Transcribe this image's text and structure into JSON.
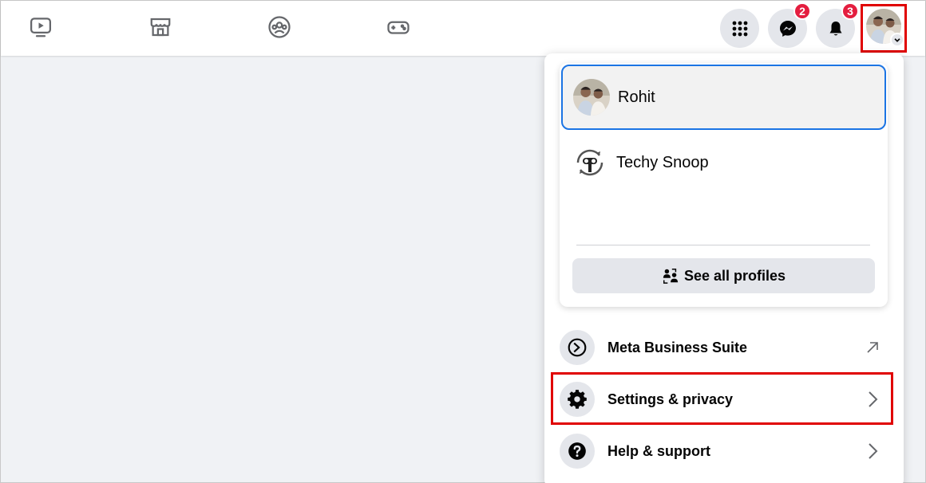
{
  "topbar": {
    "nav_icons": [
      "video-icon",
      "marketplace-icon",
      "groups-icon",
      "gaming-icon"
    ],
    "menu_button_icon": "grid-icon",
    "messenger_badge": "2",
    "notifications_badge": "3"
  },
  "profiles": [
    {
      "name": "Rohit",
      "active": true
    },
    {
      "name": "Techy Snoop",
      "active": false
    }
  ],
  "see_all_profiles": "See all profiles",
  "menu_items": [
    {
      "label": "Meta Business Suite",
      "icon": "meta-business-icon",
      "trail": "external-arrow-icon"
    },
    {
      "label": "Settings & privacy",
      "icon": "gear-icon",
      "trail": "chevron-right-icon"
    },
    {
      "label": "Help & support",
      "icon": "question-icon",
      "trail": "chevron-right-icon"
    }
  ],
  "colors": {
    "accent": "#1b74e4",
    "badge": "#e41e3f",
    "highlight": "#e00000",
    "page_bg": "#f0f2f5",
    "button_bg": "#e4e6eb"
  }
}
